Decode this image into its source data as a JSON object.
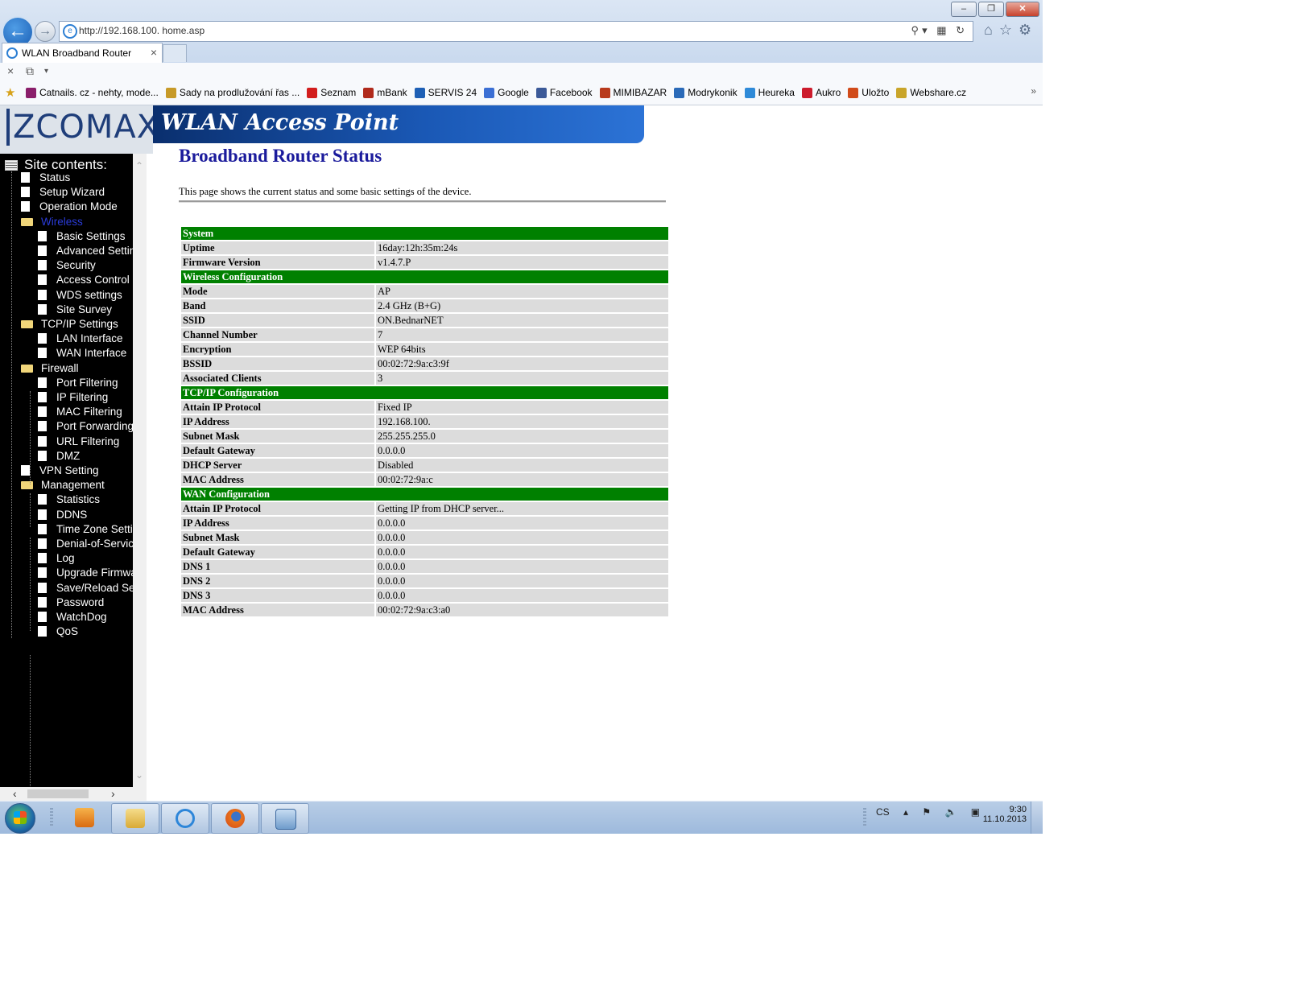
{
  "browser": {
    "url": "http://192.168.100.    home.asp",
    "tab_title": "WLAN Broadband Router",
    "window_buttons": [
      "–",
      "❐",
      "✕"
    ],
    "favorites": [
      {
        "label": "Catnails. cz - nehty, mode...",
        "color": "#8a1e6a"
      },
      {
        "label": "Sady na prodlužování řas ...",
        "color": "#c79a28"
      },
      {
        "label": "Seznam",
        "color": "#d21d1d"
      },
      {
        "label": "mBank",
        "color": "#b02a1c"
      },
      {
        "label": "SERVIS 24",
        "color": "#1d5fb5"
      },
      {
        "label": "Google",
        "color": "#3b6fd4"
      },
      {
        "label": "Facebook",
        "color": "#3b5998"
      },
      {
        "label": "MIMIBAZAR",
        "color": "#b83a1c"
      },
      {
        "label": "Modrykonik",
        "color": "#2a6ab8"
      },
      {
        "label": "Heureka",
        "color": "#2e8ad8"
      },
      {
        "label": "Aukro",
        "color": "#cc1b2c"
      },
      {
        "label": "Uložto",
        "color": "#d14b1a"
      },
      {
        "label": "Webshare.cz",
        "color": "#c9a52a"
      }
    ]
  },
  "header": {
    "logo": "ZCOMAX",
    "banner": "WLAN Access Point"
  },
  "sidebar": {
    "title": "Site contents:",
    "items": [
      {
        "label": "Status",
        "level": 1,
        "type": "doc"
      },
      {
        "label": "Setup Wizard",
        "level": 1,
        "type": "doc"
      },
      {
        "label": "Operation Mode",
        "level": 1,
        "type": "doc"
      },
      {
        "label": "Wireless",
        "level": 1,
        "type": "folder",
        "active": true
      },
      {
        "label": "Basic Settings",
        "level": 2,
        "type": "doc"
      },
      {
        "label": "Advanced Settings",
        "level": 2,
        "type": "doc"
      },
      {
        "label": "Security",
        "level": 2,
        "type": "doc"
      },
      {
        "label": "Access Control",
        "level": 2,
        "type": "doc"
      },
      {
        "label": "WDS settings",
        "level": 2,
        "type": "doc"
      },
      {
        "label": "Site Survey",
        "level": 2,
        "type": "doc"
      },
      {
        "label": "TCP/IP Settings",
        "level": 1,
        "type": "folder"
      },
      {
        "label": "LAN Interface",
        "level": 2,
        "type": "doc"
      },
      {
        "label": "WAN Interface",
        "level": 2,
        "type": "doc"
      },
      {
        "label": "Firewall",
        "level": 1,
        "type": "folder"
      },
      {
        "label": "Port Filtering",
        "level": 2,
        "type": "doc"
      },
      {
        "label": "IP Filtering",
        "level": 2,
        "type": "doc"
      },
      {
        "label": "MAC Filtering",
        "level": 2,
        "type": "doc"
      },
      {
        "label": "Port Forwarding",
        "level": 2,
        "type": "doc"
      },
      {
        "label": "URL Filtering",
        "level": 2,
        "type": "doc"
      },
      {
        "label": "DMZ",
        "level": 2,
        "type": "doc"
      },
      {
        "label": "VPN Setting",
        "level": 1,
        "type": "doc"
      },
      {
        "label": "Management",
        "level": 1,
        "type": "folder"
      },
      {
        "label": "Statistics",
        "level": 2,
        "type": "doc"
      },
      {
        "label": "DDNS",
        "level": 2,
        "type": "doc"
      },
      {
        "label": "Time Zone Setting",
        "level": 2,
        "type": "doc"
      },
      {
        "label": "Denial-of-Service",
        "level": 2,
        "type": "doc"
      },
      {
        "label": "Log",
        "level": 2,
        "type": "doc"
      },
      {
        "label": "Upgrade Firmware",
        "level": 2,
        "type": "doc"
      },
      {
        "label": "Save/Reload Settings",
        "level": 2,
        "type": "doc"
      },
      {
        "label": "Password",
        "level": 2,
        "type": "doc"
      },
      {
        "label": "WatchDog",
        "level": 2,
        "type": "doc"
      },
      {
        "label": "QoS",
        "level": 2,
        "type": "doc"
      }
    ]
  },
  "main": {
    "title": "Broadband Router Status",
    "description": "This page shows the current status and some basic settings of the device.",
    "sections": [
      {
        "title": "System",
        "rows": [
          [
            "Uptime",
            "16day:12h:35m:24s"
          ],
          [
            "Firmware Version",
            "v1.4.7.P"
          ]
        ]
      },
      {
        "title": "Wireless Configuration",
        "rows": [
          [
            "Mode",
            "AP"
          ],
          [
            "Band",
            "2.4 GHz (B+G)"
          ],
          [
            "SSID",
            "ON.BednarNET"
          ],
          [
            "Channel Number",
            "7"
          ],
          [
            "Encryption",
            "WEP 64bits"
          ],
          [
            "BSSID",
            "00:02:72:9a:c3:9f"
          ],
          [
            "Associated Clients",
            "3"
          ]
        ]
      },
      {
        "title": "TCP/IP Configuration",
        "rows": [
          [
            "Attain IP Protocol",
            "Fixed IP"
          ],
          [
            "IP Address",
            "192.168.100."
          ],
          [
            "Subnet Mask",
            "255.255.255.0"
          ],
          [
            "Default Gateway",
            "0.0.0.0"
          ],
          [
            "DHCP Server",
            "Disabled"
          ],
          [
            "MAC Address",
            "00:02:72:9a:c"
          ]
        ]
      },
      {
        "title": "WAN Configuration",
        "rows": [
          [
            "Attain IP Protocol",
            "Getting IP from DHCP server..."
          ],
          [
            "IP Address",
            "0.0.0.0"
          ],
          [
            "Subnet Mask",
            "0.0.0.0"
          ],
          [
            "Default Gateway",
            "0.0.0.0"
          ],
          [
            "DNS 1",
            "0.0.0.0"
          ],
          [
            "DNS 2",
            "0.0.0.0"
          ],
          [
            "DNS 3",
            "0.0.0.0"
          ],
          [
            "MAC Address",
            "00:02:72:9a:c3:a0"
          ]
        ]
      }
    ]
  },
  "taskbar": {
    "language": "CS",
    "time": "9:30",
    "date": "11.10.2013"
  },
  "colors": {
    "section_header": "#008000",
    "row_background": "#dcdcdc",
    "title_color": "#1b1b9c",
    "sidebar_active": "#2a3bd8"
  }
}
